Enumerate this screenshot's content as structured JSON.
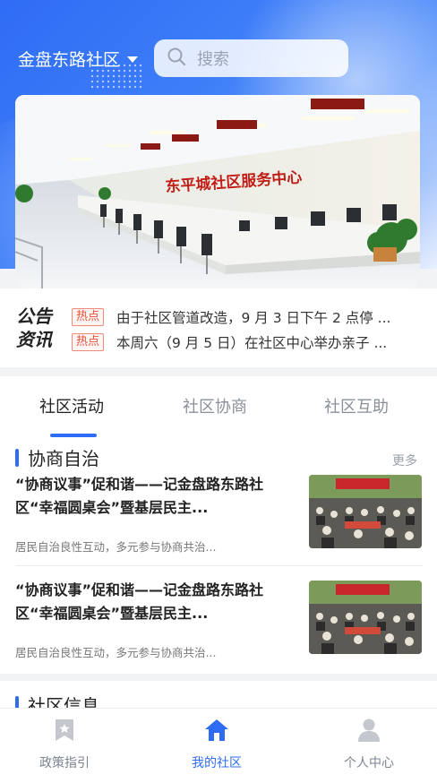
{
  "header": {
    "location": "金盘东路社区",
    "search_placeholder": "搜索"
  },
  "notice": {
    "logo_line1": "公告",
    "logo_line2": "资讯",
    "items": [
      {
        "badge": "热点",
        "text": "由于社区管道改造，9 月 3 日下午 2 点停 ..."
      },
      {
        "badge": "热点",
        "text": "本周六（9 月 5 日）在社区中心举办亲子 ..."
      }
    ]
  },
  "banner": {
    "sign_text": "东平城社区服务中心"
  },
  "tabs": [
    {
      "label": "社区活动",
      "active": true
    },
    {
      "label": "社区协商",
      "active": false
    },
    {
      "label": "社区互助",
      "active": false
    }
  ],
  "section1": {
    "title": "协商自治",
    "more": "更多",
    "articles": [
      {
        "title": "“协商议事”促和谐——记金盘路东路社区“幸福圆桌会”暨基层民主...",
        "desc": "居民自治良性互动，多元参与协商共治..."
      },
      {
        "title": "“协商议事”促和谐——记金盘路东路社区“幸福圆桌会”暨基层民主...",
        "desc": "居民自治良性互动，多元参与协商共治..."
      }
    ]
  },
  "section2": {
    "title": "社区信息"
  },
  "bottom_nav": [
    {
      "label": "政策指引",
      "icon": "bookmark-star-icon",
      "active": false
    },
    {
      "label": "我的社区",
      "icon": "home-icon",
      "active": true
    },
    {
      "label": "个人中心",
      "icon": "person-icon",
      "active": false
    }
  ],
  "colors": {
    "primary": "#2f6cf5",
    "hot": "#e8503a"
  }
}
